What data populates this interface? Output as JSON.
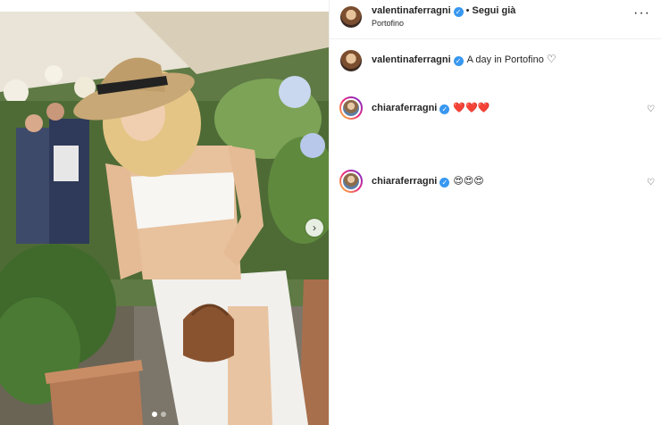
{
  "post": {
    "author": "valentinaferragni",
    "follow_status": "Segui già",
    "location": "Portofino"
  },
  "caption": {
    "username": "valentinaferragni",
    "text": "A day in Portofino"
  },
  "comments": [
    {
      "username": "chiaraferragni",
      "text": "❤️❤️❤️",
      "emoji": "red-heart"
    },
    {
      "username": "chiaraferragni",
      "text": "😍😍😍",
      "emoji": "heart-eyes-face"
    }
  ],
  "carousel": {
    "slides": 2,
    "active_index": 0
  },
  "colors": {
    "verified": "#3897f0",
    "text": "#262626",
    "heart": "#ed1c24"
  }
}
